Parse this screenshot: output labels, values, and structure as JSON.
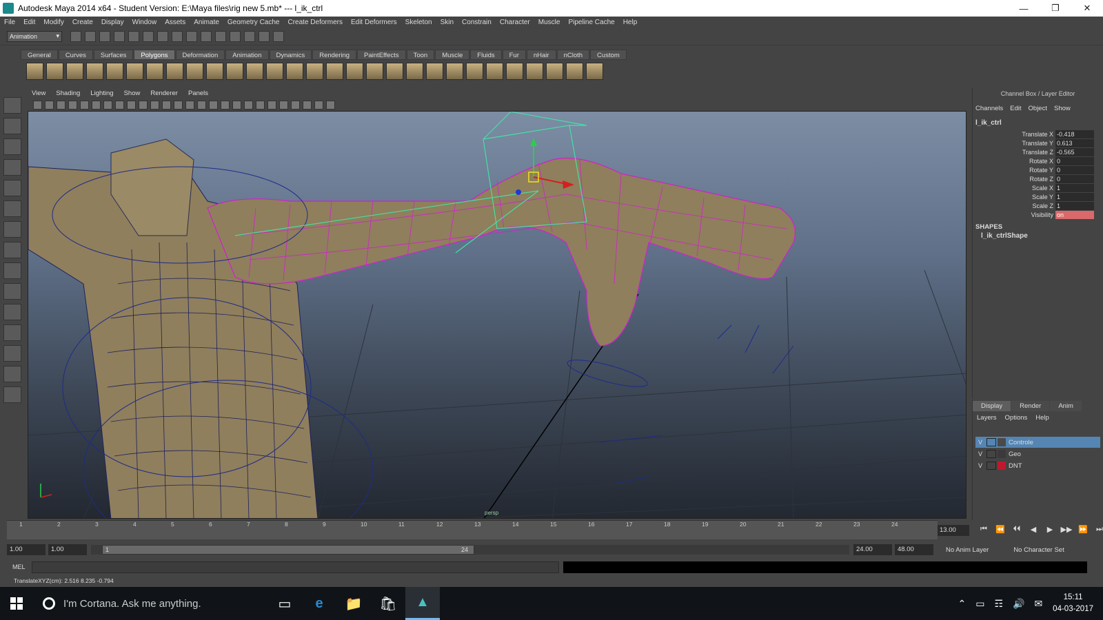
{
  "window": {
    "title": "Autodesk Maya 2014 x64 - Student Version: E:\\Maya files\\rig new 5.mb*   ---   l_ik_ctrl"
  },
  "menus": [
    "File",
    "Edit",
    "Modify",
    "Create",
    "Display",
    "Window",
    "Assets",
    "Animate",
    "Geometry Cache",
    "Create Deformers",
    "Edit Deformers",
    "Skeleton",
    "Skin",
    "Constrain",
    "Character",
    "Muscle",
    "Pipeline Cache",
    "Help"
  ],
  "status": {
    "mode": "Animation"
  },
  "shelf": {
    "tabs": [
      "General",
      "Curves",
      "Surfaces",
      "Polygons",
      "Deformation",
      "Animation",
      "Dynamics",
      "Rendering",
      "PaintEffects",
      "Toon",
      "Muscle",
      "Fluids",
      "Fur",
      "nHair",
      "nCloth",
      "Custom"
    ],
    "active": "Polygons"
  },
  "panel_menu": [
    "View",
    "Shading",
    "Lighting",
    "Show",
    "Renderer",
    "Panels"
  ],
  "viewport": {
    "camera_label": "persp"
  },
  "channel_box": {
    "title": "Channel Box / Layer Editor",
    "menu": [
      "Channels",
      "Edit",
      "Object",
      "Show"
    ],
    "object": "l_ik_ctrl",
    "attributes": [
      {
        "name": "Translate X",
        "value": "-0.418"
      },
      {
        "name": "Translate Y",
        "value": "0.613"
      },
      {
        "name": "Translate Z",
        "value": "-0.565"
      },
      {
        "name": "Rotate X",
        "value": "0"
      },
      {
        "name": "Rotate Y",
        "value": "0"
      },
      {
        "name": "Rotate Z",
        "value": "0"
      },
      {
        "name": "Scale X",
        "value": "1"
      },
      {
        "name": "Scale Y",
        "value": "1"
      },
      {
        "name": "Scale Z",
        "value": "1"
      },
      {
        "name": "Visibility",
        "value": "on"
      }
    ],
    "shapes_header": "SHAPES",
    "shape": "l_ik_ctrlShape"
  },
  "layer_editor": {
    "tabs": [
      "Display",
      "Render",
      "Anim"
    ],
    "menu": [
      "Layers",
      "Options",
      "Help"
    ],
    "layers": [
      {
        "v": "V",
        "name": "Controle",
        "color": "#4a4a4a"
      },
      {
        "v": "V",
        "name": "Geo",
        "color": "#3a3a3a"
      },
      {
        "v": "V",
        "name": "DNT",
        "color": "#c0182c"
      }
    ]
  },
  "timeline": {
    "ticks": [
      "1",
      "2",
      "3",
      "4",
      "5",
      "6",
      "7",
      "8",
      "9",
      "10",
      "11",
      "12",
      "13",
      "14",
      "15",
      "16",
      "17",
      "18",
      "19",
      "20",
      "21",
      "22",
      "23",
      "24"
    ],
    "current_frame": "13.00",
    "playback": [
      "⏮",
      "⏪",
      "⏴⏴",
      "◀",
      "▶",
      "▶▶",
      "⏩",
      "⏭"
    ]
  },
  "range": {
    "start": "1.00",
    "start2": "1.00",
    "slider_start": "1",
    "slider_end": "24",
    "end": "24.00",
    "end2": "48.00",
    "anim_layer": "No Anim Layer",
    "character_set": "No Character Set"
  },
  "command": {
    "label": "MEL"
  },
  "help": {
    "text": "TranslateXYZ(cm):   2.516       8.235      -0.794"
  },
  "taskbar": {
    "cortana": "I'm Cortana. Ask me anything.",
    "time": "15:11",
    "date": "04-03-2017"
  }
}
